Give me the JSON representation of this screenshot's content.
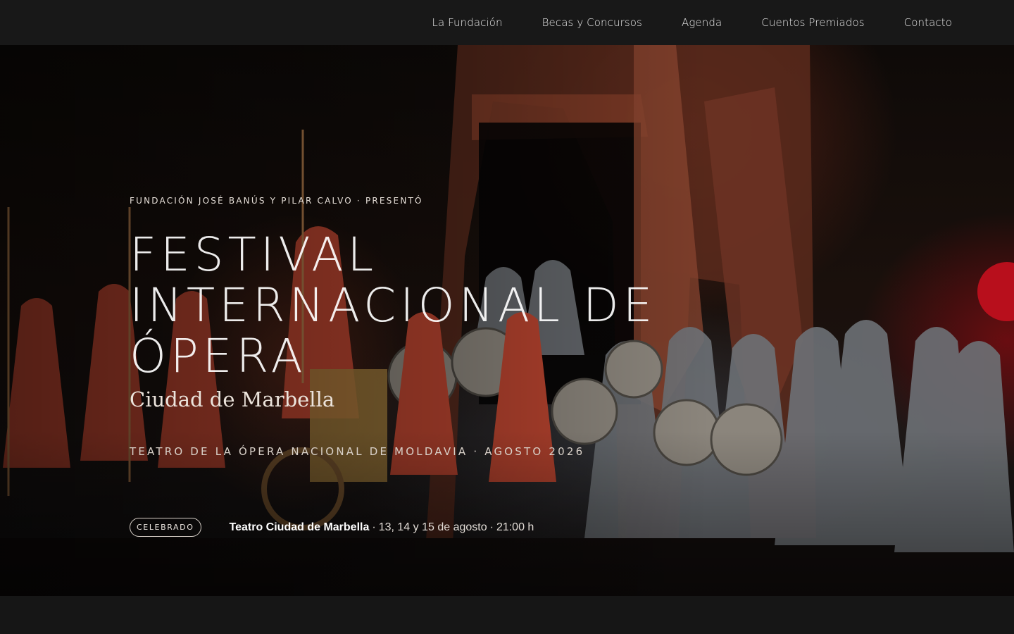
{
  "nav": {
    "items": [
      {
        "label": "La Fundación"
      },
      {
        "label": "Becas y Concursos"
      },
      {
        "label": "Agenda"
      },
      {
        "label": "Cuentos Premiados"
      },
      {
        "label": "Contacto"
      }
    ]
  },
  "hero": {
    "eyebrow": "FUNDACIÓN JOSÉ BANÚS Y PILAR CALVO · PRESENTÓ",
    "title": "FESTIVAL INTERNACIONAL DE ÓPERA",
    "subtitle": "Ciudad de Marbella",
    "venue_line": "TEATRO DE LA ÓPERA NACIONAL DE MOLDAVIA · AGOSTO 2026",
    "status_badge": "CELEBRADO",
    "place": "Teatro Ciudad de Marbella",
    "dates": "13, 14 y 15 de agosto",
    "time": "21:00 h",
    "separator": "·",
    "image_alt": "opera-stage-performance-photo"
  },
  "colors": {
    "nav_bg": "#181818",
    "page_bg": "#161616",
    "text": "#ffffff"
  }
}
